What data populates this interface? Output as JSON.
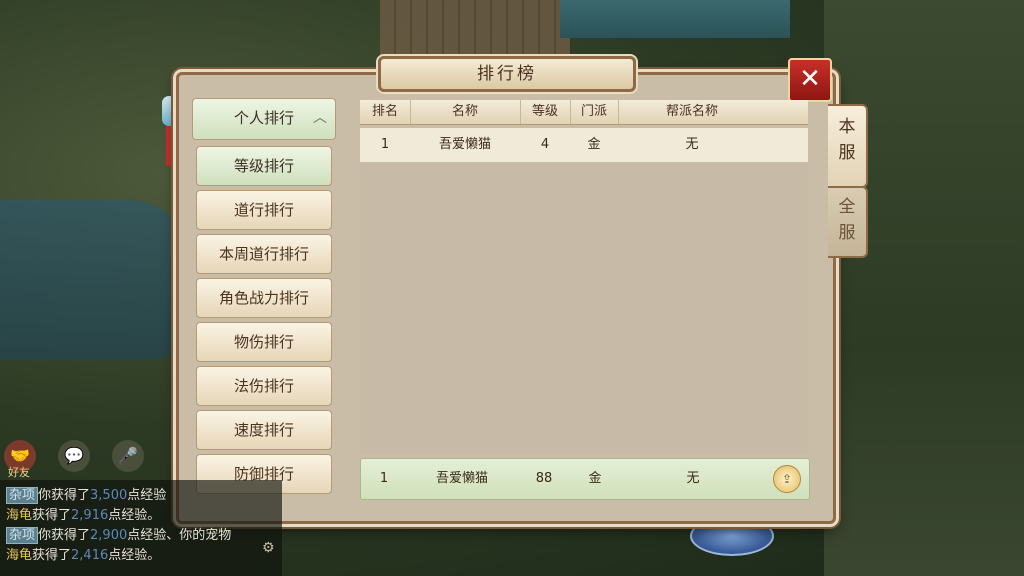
{
  "title": "排行榜",
  "close_label": "✕",
  "menu": {
    "header": "个人排行",
    "items": [
      "等级排行",
      "道行排行",
      "本周道行排行",
      "角色战力排行",
      "物伤排行",
      "法伤排行",
      "速度排行",
      "防御排行"
    ]
  },
  "table": {
    "columns": [
      "排名",
      "名称",
      "等级",
      "门派",
      "帮派名称"
    ],
    "rows": [
      {
        "rank": "1",
        "name": "吾爱懒猫",
        "level": "4",
        "school": "金",
        "guild": "无"
      }
    ],
    "my_rank": {
      "rank": "1",
      "name": "吾爱懒猫",
      "level": "88",
      "school": "金",
      "guild": "无"
    }
  },
  "server_tabs": [
    {
      "chars": [
        "本",
        "服"
      ]
    },
    {
      "chars": [
        "全",
        "服"
      ]
    }
  ],
  "share_label": "分享",
  "bottom_icons": {
    "friend_label": "好友"
  },
  "chat": {
    "lines": [
      {
        "tag": "杂项",
        "text_a": "你获得了",
        "num": "3,500",
        "text_b": "点经验"
      },
      {
        "tag": "海龟",
        "text_a": "获得了",
        "num": "2,916",
        "text_b": "点经验。"
      },
      {
        "tag": "杂项",
        "text_a": "你获得了",
        "num": "2,900",
        "text_b": "点经验、你的宠物"
      },
      {
        "tag": "海龟",
        "text_a": "获得了",
        "num": "2,416",
        "text_b": "点经验。"
      }
    ]
  },
  "colors": {
    "panel": "#c9bda8",
    "border": "#8e6a46",
    "active": "#cfe0bd",
    "close": "#c7302a"
  }
}
